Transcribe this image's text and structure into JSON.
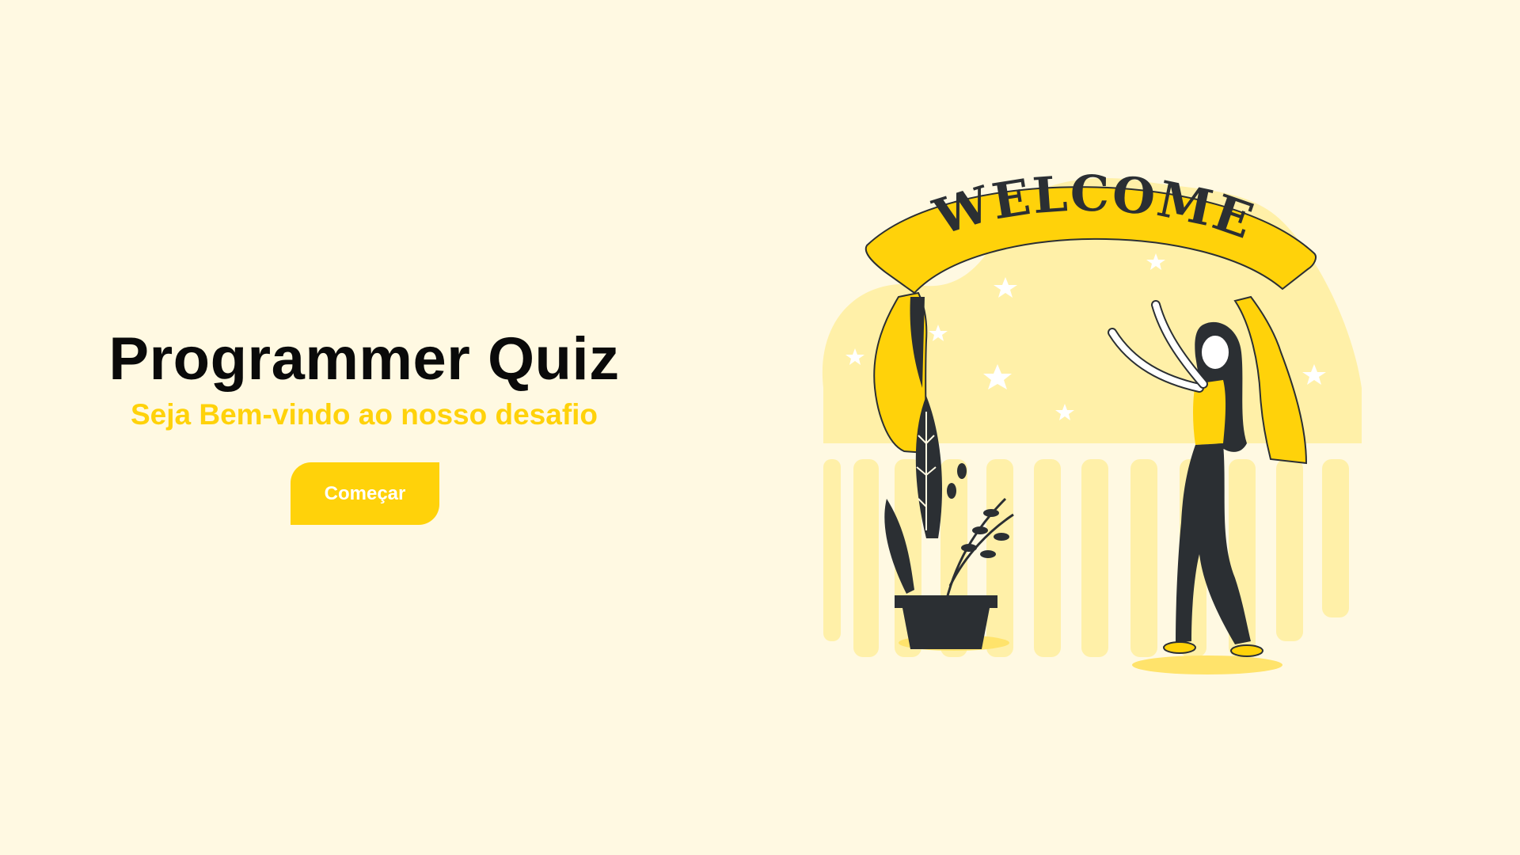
{
  "hero": {
    "title": "Programmer Quiz",
    "subtitle": "Seja Bem-vindo ao nosso desafio",
    "start_label": "Começar"
  },
  "illustration": {
    "banner_text": "WELCOME"
  },
  "colors": {
    "background": "#fff9e2",
    "accent": "#ffd20a",
    "accent_light": "#fff0a8",
    "dark": "#2b2f33",
    "title": "#0a0a0a"
  }
}
